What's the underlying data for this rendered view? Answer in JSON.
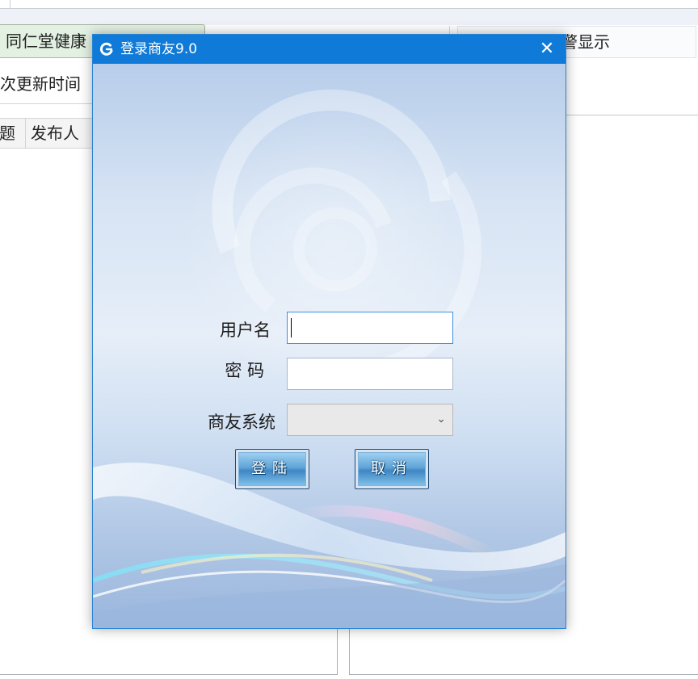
{
  "background_app": {
    "tab_label": "同仁堂健康",
    "right_header": "警显示",
    "update_label": "次更新时间",
    "columns": [
      "题",
      "发布人"
    ]
  },
  "dialog": {
    "title": "登录商友9.0",
    "close_glyph": "✕",
    "form": {
      "username_label": "用户名",
      "username_value": "",
      "password_label": "密 码",
      "password_value": "",
      "system_label": "商友系统",
      "system_value": "",
      "system_arrow": "⌄"
    },
    "buttons": {
      "login": "登陆",
      "cancel": "取消"
    }
  },
  "colors": {
    "titlebar": "#0f7ad7",
    "button_gradient_mid": "#3f86c3"
  }
}
